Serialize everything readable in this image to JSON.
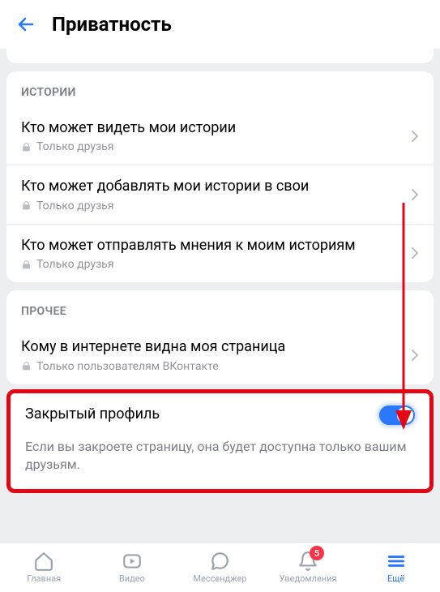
{
  "header": {
    "title": "Приватность"
  },
  "sections": {
    "stories": {
      "header": "ИСТОРИИ",
      "items": [
        {
          "title": "Кто может видеть мои истории",
          "value": "Только друзья"
        },
        {
          "title": "Кто может добавлять мои истории в свои",
          "value": "Только друзья"
        },
        {
          "title": "Кто может отправлять мнения к моим историям",
          "value": "Только друзья"
        }
      ]
    },
    "other": {
      "header": "ПРОЧЕЕ",
      "items": [
        {
          "title": "Кому в интернете видна моя страница",
          "value": "Только пользователям ВКонтакте"
        }
      ]
    },
    "closed_profile": {
      "title": "Закрытый профиль",
      "enabled": true,
      "description": "Если вы закроете страницу, она будет доступна только вашим друзьям."
    }
  },
  "nav": {
    "home": "Главная",
    "video": "Видео",
    "messenger": "Мессенджер",
    "notifications": "Уведомления",
    "more": "Ещё",
    "badge_count": "5"
  }
}
